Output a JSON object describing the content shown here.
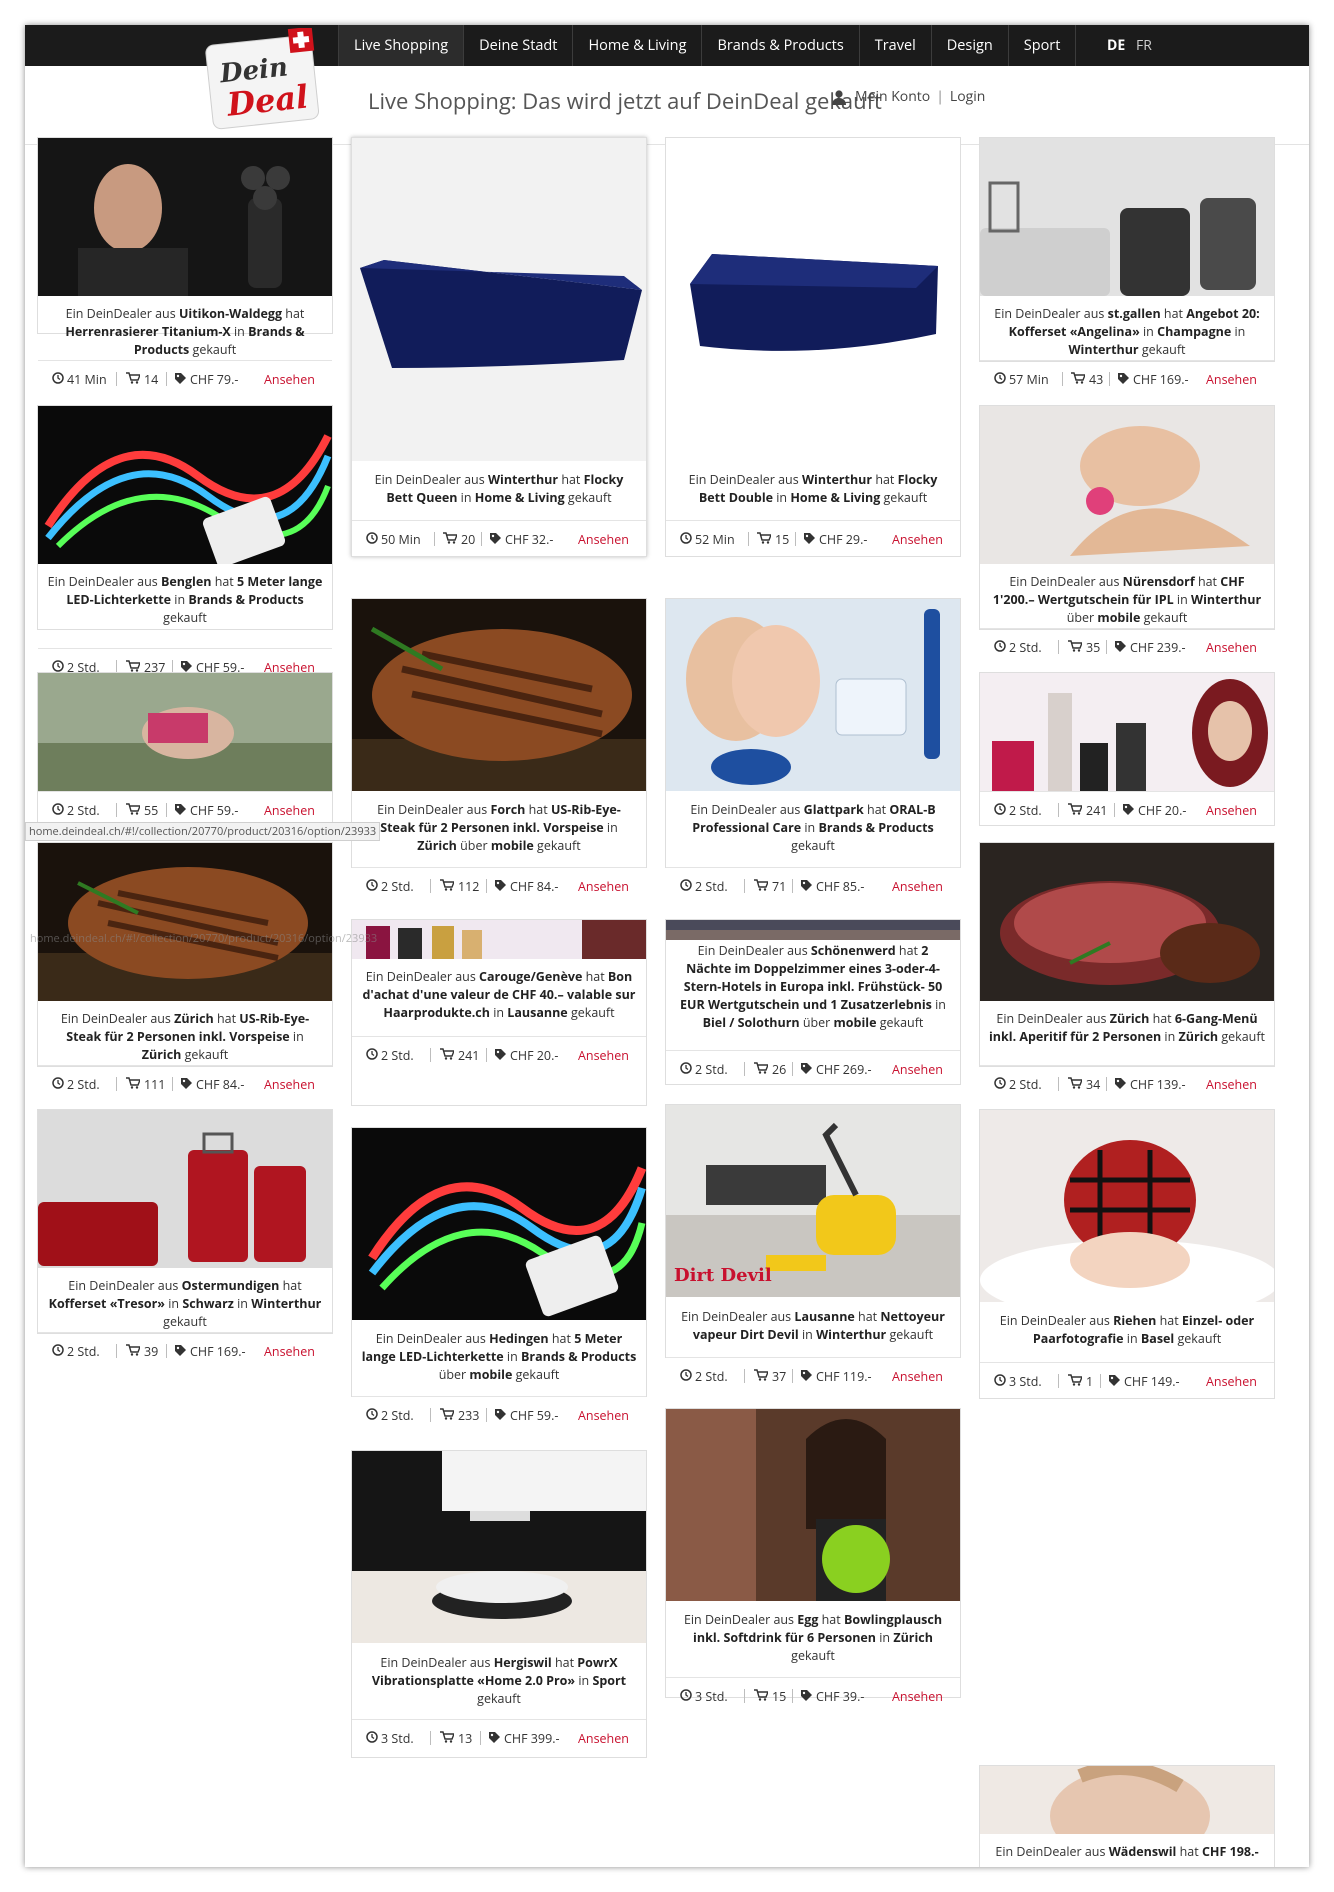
{
  "nav": {
    "items": [
      {
        "label": "Live Shopping",
        "active": true
      },
      {
        "label": "Deine Stadt"
      },
      {
        "label": "Home & Living"
      },
      {
        "label": "Brands & Products"
      },
      {
        "label": "Travel"
      },
      {
        "label": "Design"
      },
      {
        "label": "Sport"
      }
    ],
    "lang_de": "DE",
    "lang_fr": "FR"
  },
  "logo": {
    "line1": "Dein",
    "line2": "Deal"
  },
  "header": {
    "title": "Live Shopping: Das wird jetzt auf DeinDeal gekauft"
  },
  "account": {
    "mein_konto": "Mein Konto",
    "separator": "|",
    "login": "Login"
  },
  "tooltip": "home.deindeal.ch/#!/collection/20770/product/20316/option/23933",
  "common": {
    "ansehen": "Ansehen"
  },
  "cards": [
    {
      "desc": "Ein DeinDealer aus <b>Uitikon-Waldegg</b> hat <b>Herrenrasierer Titanium-X</b> in <b>Brands &amp; Products</b> gekauft",
      "time": "41 Min",
      "count": "14",
      "price": "CHF 79.-",
      "image": "shaver"
    },
    {
      "desc": "Ein DeinDealer aus <b>Benglen</b> hat <b>5 Meter lange LED-Lichterkette</b> in <b>Brands &amp; Products</b> gekauft",
      "time": "2 Std.",
      "count": "237",
      "price": "CHF 59.-",
      "image": "led"
    },
    {
      "desc": "",
      "time": "2 Std.",
      "count": "55",
      "price": "CHF 59.-",
      "image": "girl"
    },
    {
      "desc": "Ein DeinDealer aus <b>Zürich</b> hat <b>US-Rib-Eye-Steak für 2 Personen inkl. Vorspeise</b> in <b>Zürich</b> gekauft",
      "time": "2 Std.",
      "count": "111",
      "price": "CHF 84.-",
      "image": "steak"
    },
    {
      "desc": "Ein DeinDealer aus <b>Ostermundigen</b> hat <b>Kofferset «Tresor»</b> in <b>Schwarz</b> in <b>Winterthur</b> gekauft",
      "time": "2 Std.",
      "count": "39",
      "price": "CHF 169.-",
      "image": "redsuitcase"
    },
    {
      "desc": "Ein DeinDealer aus <b>Winterthur</b> hat <b>Flocky Bett Queen</b> in <b>Home &amp; Living</b> gekauft",
      "time": "50 Min",
      "count": "20",
      "price": "CHF 32.-",
      "image": "mattress"
    },
    {
      "desc": "Ein DeinDealer aus <b>Forch</b> hat <b>US-Rib-Eye-Steak für 2 Personen inkl. Vorspeise</b> in <b>Zürich</b> über <b>mobile</b> gekauft",
      "time": "2 Std.",
      "count": "112",
      "price": "CHF 84.-",
      "image": "steak"
    },
    {
      "desc": "Ein DeinDealer aus <b>Carouge/Genève</b> hat <b>Bon d'achat d'une valeur de CHF 40.– valable sur Haarprodukte.ch</b> in <b>Lausanne</b> gekauft",
      "time": "2 Std.",
      "count": "241",
      "price": "CHF 20.-",
      "image": "hairstrip"
    },
    {
      "desc": "Ein DeinDealer aus <b>Hedingen</b> hat <b>5 Meter lange LED-Lichterkette</b> in <b>Brands &amp; Products</b> über <b>mobile</b> gekauft",
      "time": "2 Std.",
      "count": "233",
      "price": "CHF 59.-",
      "image": "led"
    },
    {
      "desc": "Ein DeinDealer aus <b>Hergiswil</b> hat <b>PowrX Vibrationsplatte «Home 2.0 Pro»</b> in <b>Sport</b> gekauft",
      "time": "3 Std.",
      "count": "13",
      "price": "CHF 399.-",
      "image": "vibration"
    },
    {
      "desc": "Ein DeinDealer aus <b>Winterthur</b> hat <b>Flocky Bett Double</b> in <b>Home &amp; Living</b> gekauft",
      "time": "52 Min",
      "count": "15",
      "price": "CHF 29.-",
      "image": "mattress"
    },
    {
      "desc": "Ein DeinDealer aus <b>Glattpark</b> hat <b>ORAL-B Professional Care</b> in <b>Brands &amp; Products</b> gekauft",
      "time": "2 Std.",
      "count": "71",
      "price": "CHF 85.-",
      "image": "oralb"
    },
    {
      "desc": "Ein DeinDealer aus <b>Schönenwerd</b> hat <b>2 Nächte im Doppelzimmer eines 3-oder-4-Stern-Hotels in Europa inkl. Frühstück- 50 EUR Wertgutschein und 1 Zusatzerlebnis</b> in <b>Biel / Solothurn</b> über <b>mobile</b> gekauft",
      "time": "2 Std.",
      "count": "26",
      "price": "CHF 269.-",
      "image": "hotelstrip"
    },
    {
      "desc": "Ein DeinDealer aus <b>Lausanne</b> hat <b>Nettoyeur vapeur Dirt Devil</b> in <b>Winterthur</b> gekauft",
      "time": "2 Std.",
      "count": "37",
      "price": "CHF 119.-",
      "image": "dirtdevil",
      "brand": "Dirt Devil"
    },
    {
      "desc": "Ein DeinDealer aus <b>Egg</b> hat <b>Bowlingplausch inkl. Softdrink für 6 Personen</b> in <b>Zürich</b> gekauft",
      "time": "3 Std.",
      "count": "15",
      "price": "CHF 39.-",
      "image": "bowling"
    },
    {
      "desc": "Ein DeinDealer aus <b>st.gallen</b> hat <b>Angebot 20: Kofferset «Angelina»</b> in <b>Champagne</b> in <b>Winterthur</b> gekauft",
      "time": "57 Min",
      "count": "43",
      "price": "CHF 169.-",
      "image": "blacksuitcase"
    },
    {
      "desc": "Ein DeinDealer aus <b>Nürensdorf</b> hat <b>CHF 1'200.– Wertgutschein für IPL</b> in <b>Winterthur</b> über <b>mobile</b> gekauft",
      "time": "2 Std.",
      "count": "35",
      "price": "CHF 239.-",
      "image": "ipl"
    },
    {
      "desc": "",
      "time": "2 Std.",
      "count": "241",
      "price": "CHF 20.-",
      "image": "hairproducts"
    },
    {
      "desc": "Ein DeinDealer aus <b>Zürich</b> hat <b>6-Gang-Menü inkl. Aperitif für 2 Personen</b> in <b>Zürich</b> gekauft",
      "time": "2 Std.",
      "count": "34",
      "price": "CHF 139.-",
      "image": "beef"
    },
    {
      "desc": "Ein DeinDealer aus <b>Riehen</b> hat <b>Einzel- oder Paarfotografie</b> in <b>Basel</b> gekauft",
      "time": "3 Std.",
      "count": "1",
      "price": "CHF 149.-",
      "image": "baby"
    },
    {
      "desc": "Ein DeinDealer aus <b>Wädenswil</b> hat <b>CHF 198.-</b>",
      "time": "",
      "count": "",
      "price": "",
      "image": "woman2"
    }
  ]
}
